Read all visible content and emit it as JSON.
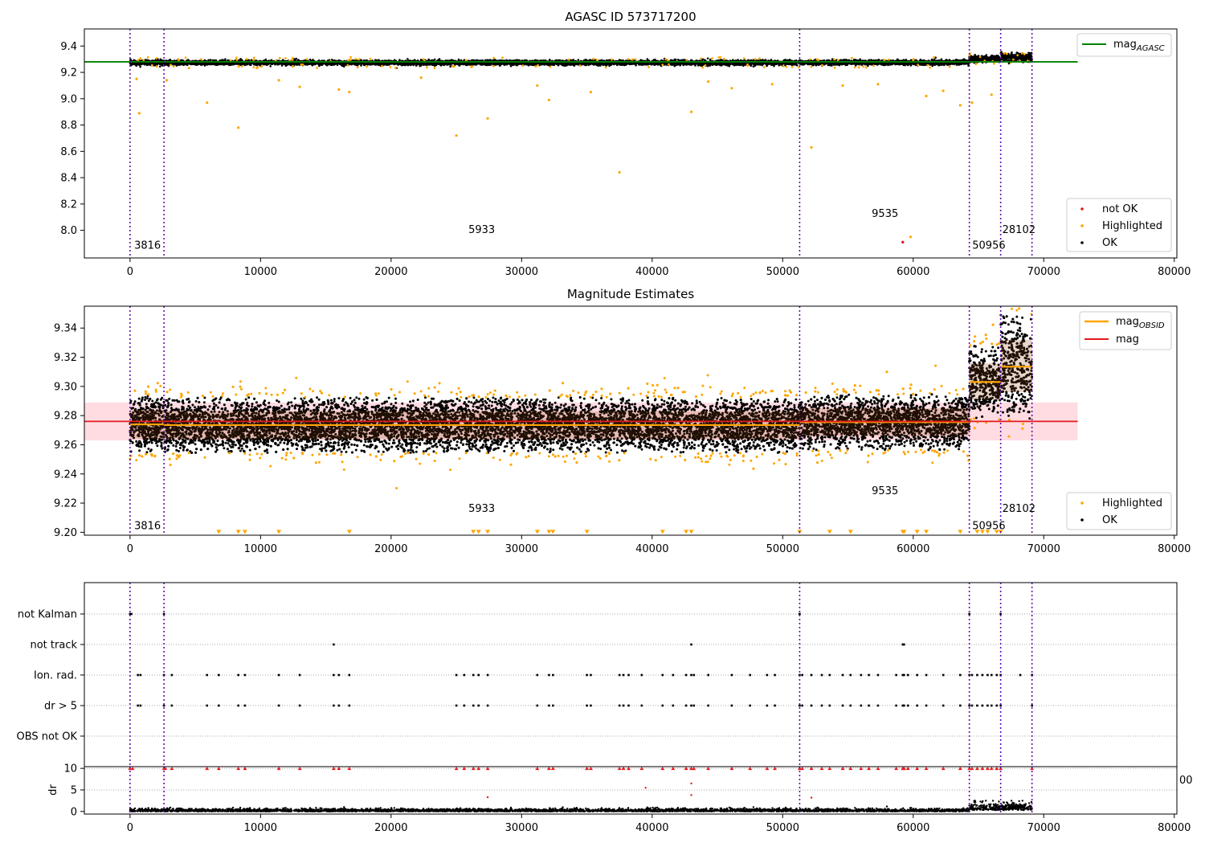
{
  "chart_data": [
    {
      "type": "scatter",
      "title": "AGASC ID 573717200",
      "xlim": [
        -3500,
        80200
      ],
      "ylim": [
        7.79,
        9.53
      ],
      "xticks": [
        "0",
        "10000",
        "20000",
        "30000",
        "40000",
        "50000",
        "60000",
        "70000",
        "80000"
      ],
      "yticks": [
        "8.0",
        "8.2",
        "8.4",
        "8.6",
        "8.8",
        "9.0",
        "9.2",
        "9.4"
      ],
      "agasc_mag": 9.28,
      "agasc_line_x": [
        -3500,
        72600
      ],
      "obsid_boundaries": [
        0,
        2600,
        51300,
        64300,
        66700,
        69100
      ],
      "obsid_annotations": [
        {
          "text": "3816",
          "x": 200,
          "y": 7.86
        },
        {
          "text": "5933",
          "x": 25800,
          "y": 7.98
        },
        {
          "text": "9535",
          "x": 56700,
          "y": 8.1
        },
        {
          "text": "50956",
          "x": 64400,
          "y": 7.86
        },
        {
          "text": "28102",
          "x": 66700,
          "y": 7.98
        }
      ],
      "series": [
        {
          "name": "not OK",
          "color": "#e31a1c",
          "points": [
            [
              59200,
              7.91
            ]
          ]
        },
        {
          "name": "Highlighted",
          "color": "#ffa500",
          "points": [
            [
              700,
              8.89
            ],
            [
              5900,
              8.97
            ],
            [
              8300,
              8.78
            ],
            [
              13000,
              9.09
            ],
            [
              16000,
              9.07
            ],
            [
              16800,
              9.05
            ],
            [
              25000,
              8.72
            ],
            [
              27400,
              8.85
            ],
            [
              32100,
              8.99
            ],
            [
              35300,
              9.05
            ],
            [
              37500,
              8.44
            ],
            [
              43000,
              8.9
            ],
            [
              46100,
              9.08
            ],
            [
              52200,
              8.63
            ],
            [
              54600,
              9.1
            ],
            [
              61000,
              9.02
            ],
            [
              62300,
              9.06
            ],
            [
              63600,
              8.95
            ],
            [
              64500,
              8.97
            ],
            [
              66000,
              9.03
            ],
            [
              59800,
              7.95
            ],
            [
              500,
              9.15
            ],
            [
              2800,
              9.14
            ],
            [
              11400,
              9.14
            ],
            [
              22300,
              9.16
            ],
            [
              31200,
              9.1
            ],
            [
              44300,
              9.13
            ],
            [
              49200,
              9.11
            ],
            [
              57300,
              9.11
            ]
          ]
        },
        {
          "name": "OK",
          "color": "#000000"
        }
      ],
      "legend": {
        "upper": [
          {
            "label_main": "mag",
            "label_sub": "AGASC",
            "color": "#008000"
          }
        ],
        "lower": [
          {
            "label": "not OK",
            "color": "#e31a1c"
          },
          {
            "label": "Highlighted",
            "color": "#ffa500"
          },
          {
            "label": "OK",
            "color": "#000000"
          }
        ]
      }
    },
    {
      "type": "scatter",
      "title": "Magnitude Estimates",
      "xlim": [
        -3500,
        80200
      ],
      "ylim": [
        9.198,
        9.355
      ],
      "xticks": [
        "0",
        "10000",
        "20000",
        "30000",
        "40000",
        "50000",
        "60000",
        "70000",
        "80000"
      ],
      "yticks": [
        "9.20",
        "9.22",
        "9.24",
        "9.26",
        "9.28",
        "9.30",
        "9.32",
        "9.34"
      ],
      "mag": 9.276,
      "mag_band": [
        9.263,
        9.289
      ],
      "obsid_means": [
        {
          "x": [
            0,
            2600
          ],
          "mean": 9.274,
          "std_lo": 9.264,
          "std_hi": 9.284
        },
        {
          "x": [
            2600,
            51300
          ],
          "mean": 9.2735,
          "std_lo": 9.264,
          "std_hi": 9.283
        },
        {
          "x": [
            51300,
            64300
          ],
          "mean": 9.2755,
          "std_lo": 9.266,
          "std_hi": 9.285
        },
        {
          "x": [
            64300,
            66700
          ],
          "mean": 9.303,
          "std_lo": 9.291,
          "std_hi": 9.316
        },
        {
          "x": [
            66700,
            69100
          ],
          "mean": 9.3135,
          "std_lo": 9.296,
          "std_hi": 9.332
        }
      ],
      "obsid_annotations": [
        {
          "text": "3816",
          "x": 200,
          "y": 9.202
        },
        {
          "text": "5933",
          "x": 25800,
          "y": 9.214
        },
        {
          "text": "9535",
          "x": 56700,
          "y": 9.226
        },
        {
          "text": "50956",
          "x": 64400,
          "y": 9.202
        },
        {
          "text": "28102",
          "x": 66700,
          "y": 9.214
        }
      ],
      "series": [
        {
          "name": "Highlighted",
          "color": "#ffa500"
        },
        {
          "name": "OK",
          "color": "#000000"
        }
      ],
      "legend": {
        "upper": [
          {
            "label_main": "mag",
            "label_sub": "OBSID",
            "color": "#ffa500"
          },
          {
            "label": "mag",
            "color": "#e31a1c"
          }
        ],
        "lower": [
          {
            "label": "Highlighted",
            "color": "#ffa500"
          },
          {
            "label": "OK",
            "color": "#000000"
          }
        ]
      }
    },
    {
      "type": "scatter",
      "xlim": [
        -3500,
        80200
      ],
      "categories": [
        "not Kalman",
        "not track",
        "Ion. rad.",
        "dr > 5",
        "OBS not OK"
      ],
      "flag_points": {
        "not Kalman": [
          0,
          100,
          2600,
          51300,
          64300,
          66700
        ],
        "not track": [
          15600,
          43000,
          59200,
          59300
        ],
        "Ion. rad.": [
          600,
          800,
          2600,
          3200,
          5900,
          6800,
          8300,
          8800,
          11400,
          13000,
          15600,
          16000,
          16800,
          25000,
          25600,
          26300,
          26700,
          27400,
          31200,
          32100,
          32400,
          35000,
          35300,
          37500,
          37800,
          38200,
          39200,
          40800,
          41600,
          42600,
          43000,
          43200,
          44300,
          46100,
          47500,
          48800,
          49400,
          51300,
          51500,
          52200,
          53000,
          53600,
          54600,
          55200,
          56000,
          56600,
          57300,
          58700,
          59200,
          59300,
          59600,
          60300,
          61000,
          62300,
          63600,
          64300,
          64500,
          64900,
          65300,
          65700,
          66000,
          66400,
          66700,
          68200,
          69100
        ],
        "dr > 5": [
          600,
          800,
          2600,
          3200,
          5900,
          6800,
          8300,
          8800,
          11400,
          13000,
          15600,
          16000,
          16800,
          25000,
          25600,
          26300,
          26700,
          27400,
          31200,
          32100,
          32400,
          35000,
          35300,
          37500,
          37800,
          38200,
          39200,
          40800,
          41600,
          42600,
          43000,
          43200,
          44300,
          46100,
          47500,
          48800,
          49400,
          51300,
          51500,
          52200,
          53000,
          53600,
          54600,
          55200,
          56000,
          56600,
          57300,
          58700,
          59200,
          59300,
          59600,
          60300,
          61000,
          62300,
          63600,
          64300,
          64500,
          64900,
          65300,
          65700,
          66000,
          66400,
          66700,
          69100
        ],
        "OBS not OK": []
      }
    },
    {
      "type": "scatter",
      "ylabel": "dr",
      "xlim": [
        -3500,
        80200
      ],
      "ylim": [
        -0.6,
        10.4
      ],
      "xticks": [
        "0",
        "10000",
        "20000",
        "30000",
        "40000",
        "50000",
        "60000",
        "70000",
        "80000"
      ],
      "yticks": [
        "0",
        "5",
        "10"
      ],
      "clipped_points_at_10": [
        0,
        200,
        2600,
        2700,
        3200,
        5900,
        6800,
        8300,
        8800,
        11400,
        13000,
        15600,
        16000,
        16800,
        25000,
        25600,
        26300,
        26700,
        27400,
        31200,
        32100,
        32400,
        35000,
        35300,
        37500,
        37800,
        38200,
        39200,
        40800,
        41600,
        42600,
        43000,
        43200,
        44300,
        46100,
        47500,
        48800,
        49400,
        51300,
        51500,
        52200,
        53000,
        53600,
        54600,
        55200,
        56000,
        56600,
        57300,
        58700,
        59200,
        59300,
        59600,
        60300,
        61000,
        62300,
        63600,
        64300,
        64500,
        64900,
        65300,
        65700,
        66000,
        66400,
        66700,
        69100
      ],
      "outliers": [
        [
          39500,
          5.5
        ],
        [
          43000,
          6.5
        ],
        [
          43000,
          3.8
        ],
        [
          27400,
          3.3
        ],
        [
          52200,
          3.2
        ]
      ],
      "stray_tick_label": "00"
    }
  ]
}
